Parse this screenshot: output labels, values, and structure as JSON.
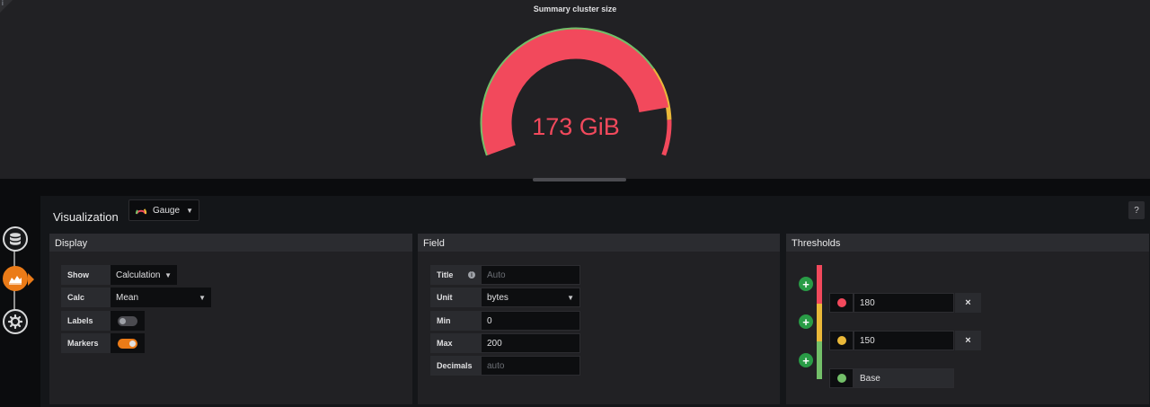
{
  "panel": {
    "title": "Summary cluster size",
    "info_icon": "i",
    "gauge_value_text": "173 GiB",
    "gauge_value": 173,
    "gauge_min": 0,
    "gauge_max": 200,
    "gauge_color": "#f2495c"
  },
  "editor": {
    "visualization_label": "Visualization",
    "viz_picker": {
      "icon": "gauge-icon",
      "label": "Gauge"
    },
    "help_label": "?"
  },
  "rail": {
    "items": [
      {
        "name": "queries",
        "icon": "database-icon",
        "active": false
      },
      {
        "name": "visualization",
        "icon": "chart-icon",
        "active": true
      },
      {
        "name": "general",
        "icon": "gear-icon",
        "active": false
      }
    ]
  },
  "display": {
    "title": "Display",
    "show_label": "Show",
    "show_value": "Calculation",
    "calc_label": "Calc",
    "calc_value": "Mean",
    "labels_label": "Labels",
    "labels_on": false,
    "markers_label": "Markers",
    "markers_on": true
  },
  "field": {
    "title": "Field",
    "title_label": "Title",
    "title_placeholder": "Auto",
    "unit_label": "Unit",
    "unit_value": "bytes",
    "min_label": "Min",
    "min_value": "0",
    "max_label": "Max",
    "max_value": "200",
    "decimals_label": "Decimals",
    "decimals_placeholder": "auto"
  },
  "thresholds": {
    "title": "Thresholds",
    "items": [
      {
        "value": "180",
        "color": "#f2495c"
      },
      {
        "value": "150",
        "color": "#fade2a"
      },
      {
        "value": "Base",
        "color": "#73bf69"
      }
    ],
    "add_label": "+",
    "remove_label": "×"
  },
  "colors": {
    "red": "#f2495c",
    "yellow": "#eab839",
    "green": "#73bf69",
    "accent": "#eb7b18"
  }
}
